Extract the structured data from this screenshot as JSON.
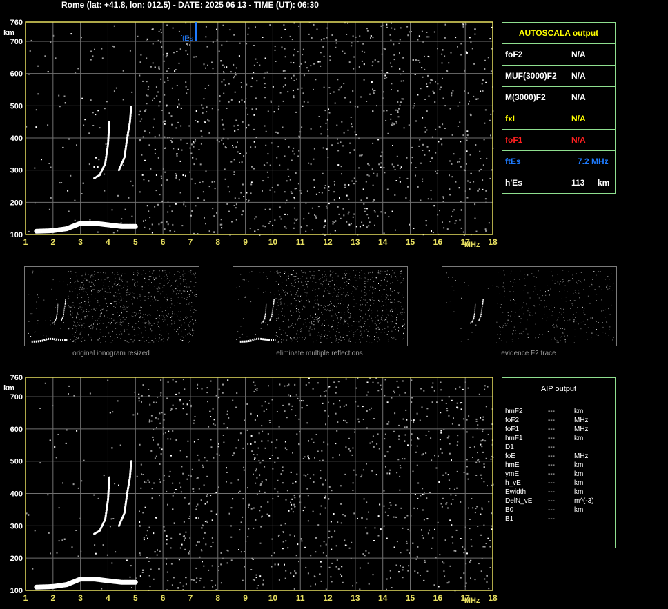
{
  "header": {
    "title": "Rome (lat: +41.8, lon: 012.5) - DATE: 2025 06 13 - TIME (UT): 06:30"
  },
  "chart_data": [
    {
      "type": "scatter",
      "title": "",
      "x_axis": {
        "ticks": [
          "1",
          "2",
          "3",
          "4",
          "5",
          "6",
          "7",
          "8",
          "9",
          "10",
          "11",
          "12",
          "13",
          "14",
          "15",
          "16",
          "17",
          "18"
        ],
        "unit": "MHz",
        "range": [
          1,
          18
        ]
      },
      "y_axis": {
        "ticks": [
          "100",
          "200",
          "300",
          "400",
          "500",
          "600",
          "700",
          "760"
        ],
        "unit": "km",
        "range": [
          100,
          760
        ]
      },
      "annotation": {
        "label": "ftEs",
        "frequency_mhz": 7.2,
        "color": "#1e7bff"
      },
      "traces": [
        {
          "name": "Es trace",
          "points": [
            [
              1.4,
              110
            ],
            [
              2,
              112
            ],
            [
              2.5,
              118
            ],
            [
              3,
              135
            ],
            [
              3.5,
              135
            ],
            [
              4,
              130
            ],
            [
              4.5,
              125
            ],
            [
              5,
              125
            ]
          ]
        },
        {
          "name": "o trace",
          "points": [
            [
              3.5,
              275
            ],
            [
              3.7,
              285
            ],
            [
              3.9,
              320
            ],
            [
              4.0,
              380
            ],
            [
              4.05,
              450
            ]
          ]
        },
        {
          "name": "x trace",
          "points": [
            [
              4.4,
              300
            ],
            [
              4.6,
              340
            ],
            [
              4.7,
              400
            ],
            [
              4.8,
              450
            ],
            [
              4.85,
              500
            ]
          ]
        }
      ],
      "grid": true
    },
    {
      "type": "scatter",
      "title": "",
      "x_axis": {
        "ticks": [
          "1",
          "2",
          "3",
          "4",
          "5",
          "6",
          "7",
          "8",
          "9",
          "10",
          "11",
          "12",
          "13",
          "14",
          "15",
          "16",
          "17",
          "18"
        ],
        "unit": "MHz",
        "range": [
          1,
          18
        ]
      },
      "y_axis": {
        "ticks": [
          "100",
          "200",
          "300",
          "400",
          "500",
          "600",
          "700",
          "760"
        ],
        "unit": "km",
        "range": [
          100,
          760
        ]
      },
      "traces": [
        {
          "name": "Es trace",
          "points": [
            [
              1.4,
              110
            ],
            [
              2,
              112
            ],
            [
              2.5,
              118
            ],
            [
              3,
              135
            ],
            [
              3.5,
              135
            ],
            [
              4,
              130
            ],
            [
              4.5,
              125
            ],
            [
              5,
              125
            ]
          ]
        },
        {
          "name": "o trace",
          "points": [
            [
              3.5,
              275
            ],
            [
              3.7,
              285
            ],
            [
              3.9,
              320
            ],
            [
              4.0,
              380
            ],
            [
              4.05,
              450
            ]
          ]
        },
        {
          "name": "x trace",
          "points": [
            [
              4.4,
              300
            ],
            [
              4.6,
              340
            ],
            [
              4.7,
              400
            ],
            [
              4.8,
              450
            ],
            [
              4.85,
              500
            ]
          ]
        }
      ],
      "grid": true
    }
  ],
  "autoscala": {
    "title": "AUTOSCALA output",
    "rows": [
      {
        "label": "foF2",
        "value": "N/A",
        "unit": "",
        "color": "#ffffff"
      },
      {
        "label": "MUF(3000)F2",
        "value": "N/A",
        "unit": "",
        "color": "#ffffff"
      },
      {
        "label": "M(3000)F2",
        "value": "N/A",
        "unit": "",
        "color": "#ffffff"
      },
      {
        "label": "fxI",
        "value": "N/A",
        "unit": "",
        "color": "#ffff00"
      },
      {
        "label": "foF1",
        "value": "N/A",
        "unit": "",
        "color": "#ff2020"
      },
      {
        "label": "ftEs",
        "value": "7.2 MHz",
        "unit": "",
        "color": "#1e7bff"
      },
      {
        "label": "h'Es",
        "value": "113",
        "unit": "km",
        "color": "#ffffff"
      }
    ]
  },
  "thumbnails": [
    {
      "caption": "original ionogram resized"
    },
    {
      "caption": "eliminate multiple reflections"
    },
    {
      "caption": "evidence F2 trace"
    }
  ],
  "aip": {
    "title": "AIP output",
    "rows": [
      {
        "param": "hmF2",
        "value": "---",
        "unit": "km"
      },
      {
        "param": "foF2",
        "value": "---",
        "unit": "MHz"
      },
      {
        "param": "foF1",
        "value": "---",
        "unit": "MHz"
      },
      {
        "param": "hmF1",
        "value": "---",
        "unit": "km"
      },
      {
        "param": "D1",
        "value": "---",
        "unit": ""
      },
      {
        "param": "foE",
        "value": "---",
        "unit": "MHz"
      },
      {
        "param": "hmE",
        "value": "---",
        "unit": "km"
      },
      {
        "param": "ymE",
        "value": "---",
        "unit": "km"
      },
      {
        "param": "h_vE",
        "value": "---",
        "unit": "km"
      },
      {
        "param": "Ewidth",
        "value": "---",
        "unit": "km"
      },
      {
        "param": "DelN_vE",
        "value": "---",
        "unit": "m^(-3)"
      },
      {
        "param": "B0",
        "value": "---",
        "unit": "km"
      },
      {
        "param": "B1",
        "value": "---",
        "unit": ""
      }
    ]
  },
  "colors": {
    "axis": "#e8e060",
    "grid": "#707070",
    "table_border": "#8fdf8f",
    "noise": "#9a9a9a"
  }
}
